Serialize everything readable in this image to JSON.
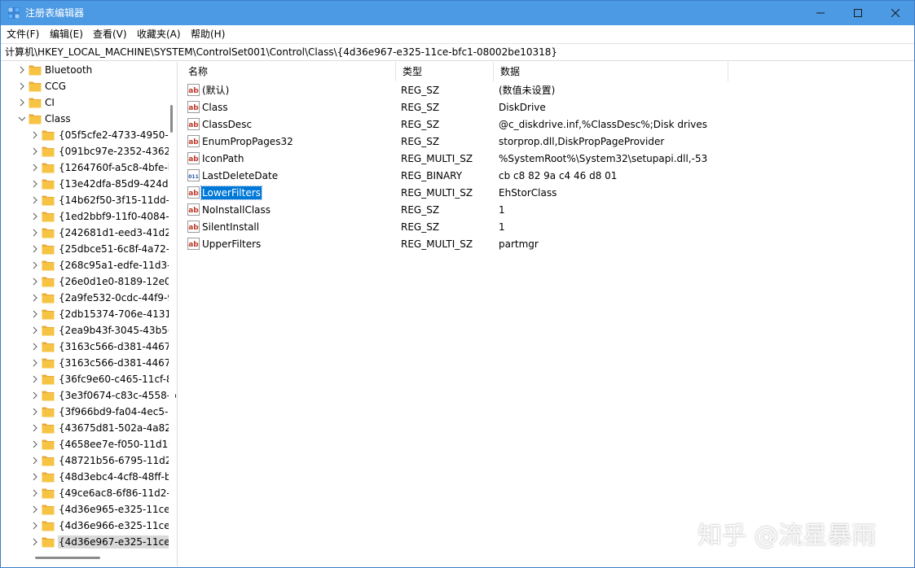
{
  "window": {
    "title": "注册表编辑器"
  },
  "menu": [
    "文件(F)",
    "编辑(E)",
    "查看(V)",
    "收藏夹(A)",
    "帮助(H)"
  ],
  "address": "计算机\\HKEY_LOCAL_MACHINE\\SYSTEM\\ControlSet001\\Control\\Class\\{4d36e967-e325-11ce-bfc1-08002be10318}",
  "tree": {
    "parents": [
      {
        "label": "Bluetooth",
        "expanded": false
      },
      {
        "label": "CCG",
        "expanded": false
      },
      {
        "label": "CI",
        "expanded": false
      },
      {
        "label": "Class",
        "expanded": true
      }
    ],
    "children": [
      "{05f5cfe2-4733-4950-a",
      "{091bc97e-2352-4362-",
      "{1264760f-a5c8-4bfe-b",
      "{13e42dfa-85d9-424d-",
      "{14b62f50-3f15-11dd-",
      "{1ed2bbf9-11f0-4084-",
      "{242681d1-eed3-41d2",
      "{25dbce51-6c8f-4a72-",
      "{268c95a1-edfe-11d3-",
      "{26e0d1e0-8189-12e0",
      "{2a9fe532-0cdc-44f9-9",
      "{2db15374-706e-4131",
      "{2ea9b43f-3045-43b5-",
      "{3163c566-d381-4467-",
      "{3163c566-d381-4467-",
      "{36fc9e60-c465-11cf-8",
      "{3e3f0674-c83c-4558-b",
      "{3f966bd9-fa04-4ec5-9",
      "{43675d81-502a-4a82",
      "{4658ee7e-f050-11d1-",
      "{48721b56-6795-11d2",
      "{48d3ebc4-4cf8-48ff-b",
      "{49ce6ac8-6f86-11d2-",
      "{4d36e965-e325-11ce-",
      "{4d36e966-e325-11ce-",
      "{4d36e967-e325-11ce-"
    ],
    "selected_child": "{4d36e967-e325-11ce-"
  },
  "columns": {
    "name": "名称",
    "type": "类型",
    "data": "数据"
  },
  "values": [
    {
      "name": "(默认)",
      "type": "REG_SZ",
      "data": "(数值未设置)",
      "icon": "string-value-icon"
    },
    {
      "name": "Class",
      "type": "REG_SZ",
      "data": "DiskDrive",
      "icon": "string-value-icon"
    },
    {
      "name": "ClassDesc",
      "type": "REG_SZ",
      "data": "@c_diskdrive.inf,%ClassDesc%;Disk drives",
      "icon": "string-value-icon"
    },
    {
      "name": "EnumPropPages32",
      "type": "REG_SZ",
      "data": "storprop.dll,DiskPropPageProvider",
      "icon": "string-value-icon"
    },
    {
      "name": "IconPath",
      "type": "REG_MULTI_SZ",
      "data": "%SystemRoot%\\System32\\setupapi.dll,-53",
      "icon": "string-value-icon"
    },
    {
      "name": "LastDeleteDate",
      "type": "REG_BINARY",
      "data": "cb c8 82 9a c4 46 d8 01",
      "icon": "binary-value-icon"
    },
    {
      "name": "LowerFilters",
      "type": "REG_MULTI_SZ",
      "data": "EhStorClass",
      "icon": "string-value-icon",
      "selected": true
    },
    {
      "name": "NoInstallClass",
      "type": "REG_SZ",
      "data": "1",
      "icon": "string-value-icon"
    },
    {
      "name": "SilentInstall",
      "type": "REG_SZ",
      "data": "1",
      "icon": "string-value-icon"
    },
    {
      "name": "UpperFilters",
      "type": "REG_MULTI_SZ",
      "data": "partmgr",
      "icon": "string-value-icon"
    }
  ],
  "watermark": "知乎 @流星暴雨",
  "colors": {
    "titlebar": "#4c9ae4",
    "selection": "#0078d7",
    "folder": "#f6c343"
  }
}
